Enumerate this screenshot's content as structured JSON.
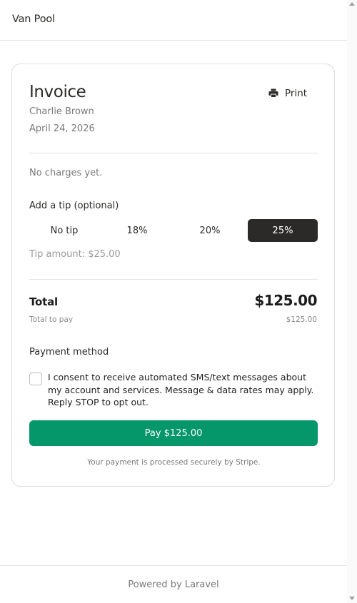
{
  "header": {
    "brand": "Van Pool"
  },
  "invoice": {
    "title": "Invoice",
    "customer": "Charlie Brown",
    "date": "April 24, 2026",
    "print_label": "Print",
    "no_charges": "No charges yet."
  },
  "tip": {
    "title": "Add a tip (optional)",
    "options": [
      {
        "label": "No tip",
        "selected": false
      },
      {
        "label": "18%",
        "selected": false
      },
      {
        "label": "20%",
        "selected": false
      },
      {
        "label": "25%",
        "selected": true
      }
    ],
    "amount_text": "Tip amount: $25.00"
  },
  "totals": {
    "total_label": "Total",
    "total_value": "$125.00",
    "to_pay_label": "Total to pay",
    "to_pay_value": "$125.00"
  },
  "payment": {
    "title": "Payment method",
    "consent_checked": false,
    "consent_text": "I consent to receive automated SMS/text messages about my account and services. Message & data rates may apply. Reply STOP to opt out.",
    "pay_button": "Pay $125.00",
    "secure_note": "Your payment is processed securely by Stripe."
  },
  "footer": {
    "text": "Powered by Laravel"
  },
  "colors": {
    "accent_green": "#059669",
    "selected_tip_bg": "#2b2a28"
  },
  "icons": {
    "print": "printer-icon",
    "checkbox": "checkbox-unchecked"
  }
}
